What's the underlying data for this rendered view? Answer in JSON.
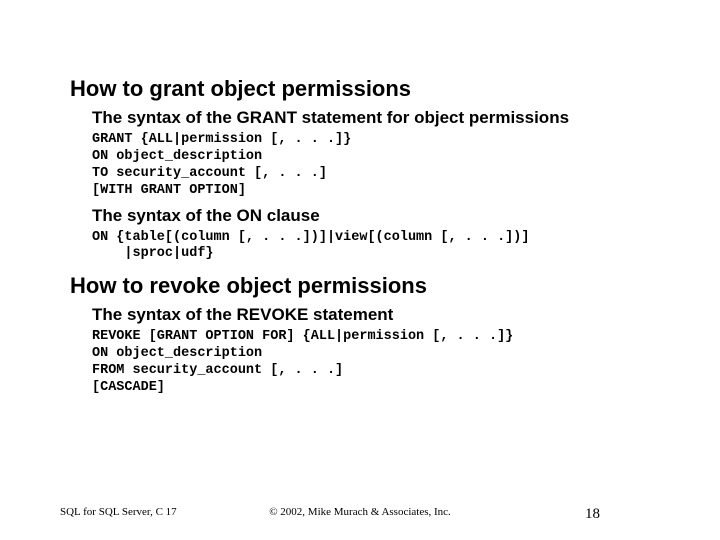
{
  "slide": {
    "heading1": "How to grant object permissions",
    "sub1": "The syntax of the GRANT statement for object permissions",
    "code1": "GRANT {ALL|permission [, . . .]}\nON object_description\nTO security_account [, . . .]\n[WITH GRANT OPTION]",
    "sub2": "The syntax of the ON clause",
    "code2": "ON {table[(column [, . . .])]|view[(column [, . . .])]\n    |sproc|udf}",
    "heading2": "How to revoke object permissions",
    "sub3": "The syntax of the REVOKE statement",
    "code3": "REVOKE [GRANT OPTION FOR] {ALL|permission [, . . .]}\nON object_description\nFROM security_account [, . . .]\n[CASCADE]"
  },
  "footer": {
    "left": "SQL for SQL Server, C 17",
    "center": "© 2002, Mike Murach & Associates, Inc.",
    "right": "18"
  }
}
